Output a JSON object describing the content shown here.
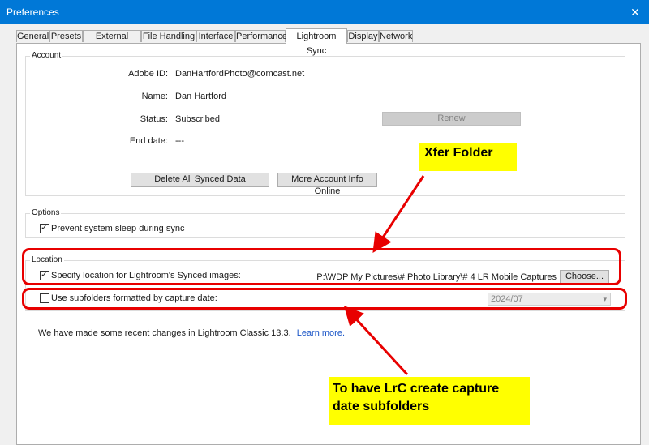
{
  "window": {
    "title": "Preferences",
    "close_glyph": "✕"
  },
  "tabs": [
    {
      "label": "General"
    },
    {
      "label": "Presets"
    },
    {
      "label": "External Editing"
    },
    {
      "label": "File Handling"
    },
    {
      "label": "Interface"
    },
    {
      "label": "Performance"
    },
    {
      "label": "Lightroom Sync",
      "active": true
    },
    {
      "label": "Display"
    },
    {
      "label": "Network"
    }
  ],
  "account": {
    "group_title": "Account",
    "adobe_id_label": "Adobe ID:",
    "adobe_id_value": "DanHartfordPhoto@comcast.net",
    "name_label": "Name:",
    "name_value": "Dan Hartford",
    "status_label": "Status:",
    "status_value": "Subscribed",
    "end_date_label": "End date:",
    "end_date_value": "---",
    "renew_button": "Renew",
    "delete_button": "Delete All Synced Data",
    "more_info_button": "More Account Info Online"
  },
  "options": {
    "group_title": "Options",
    "prevent_sleep_label": "Prevent system sleep during sync",
    "prevent_sleep_checked": true
  },
  "location": {
    "group_title": "Location",
    "specify_label": "Specify location for Lightroom's Synced images:",
    "specify_checked": true,
    "path_value": "P:\\WDP My Pictures\\# Photo Library\\# 4 LR Mobile Captures",
    "choose_button": "Choose...",
    "subfolders_label": "Use subfolders formatted by capture date:",
    "subfolders_checked": false,
    "date_format_value": "2024/07"
  },
  "footer": {
    "message": "We have made some recent changes in Lightroom Classic 13.3.",
    "learn_more": "Learn more."
  },
  "annotations": {
    "xfer_folder": "Xfer Folder",
    "capture_date_line1": "To have LrC create capture",
    "capture_date_line2": "date subfolders",
    "highlight_color": "#ffff00",
    "red_color": "#e80000"
  },
  "icons": {
    "checkmark": "check-icon",
    "dropdown": "chevron-down-icon",
    "close": "close-icon"
  }
}
